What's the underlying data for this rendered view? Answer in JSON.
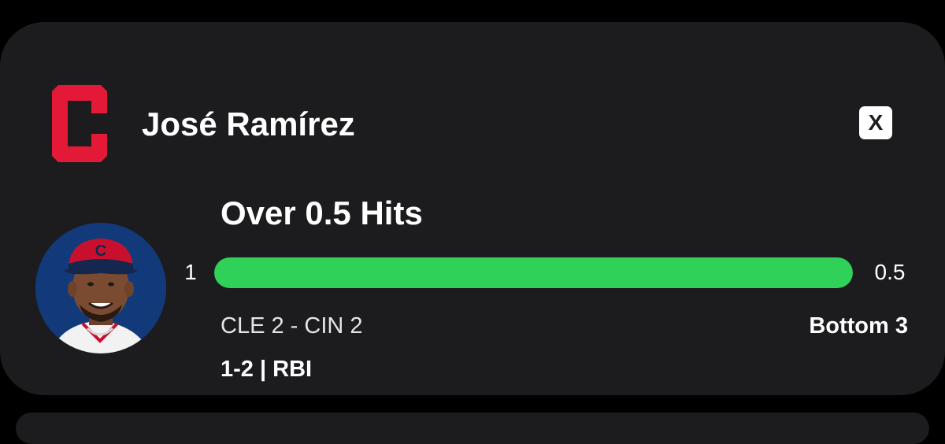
{
  "player": {
    "name": "José Ramírez",
    "team_logo_icon": "cleveland-c-logo",
    "team_color": "#e31937"
  },
  "close_label": "X",
  "prop": {
    "title": "Over 0.5 Hits",
    "current": "1",
    "target": "0.5",
    "progress_fraction": 1.0,
    "progress_color": "#30d158"
  },
  "game": {
    "score": "CLE 2 - CIN 2",
    "inning": "Bottom 3"
  },
  "player_stats": "1-2 | RBI"
}
